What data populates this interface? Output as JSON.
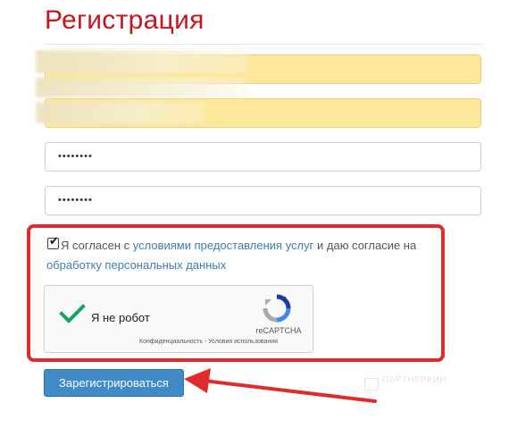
{
  "page": {
    "title": "Регистрация"
  },
  "fields": {
    "password": "••••••••",
    "password_confirm": "••••••••"
  },
  "consent": {
    "prefix": "Я согласен с ",
    "terms_link": "условиями предоставления услуг",
    "middle": " и даю согласие на ",
    "privacy_link": "обработку персональных данных",
    "checked": true
  },
  "captcha": {
    "label": "Я не робот",
    "brand": "reCAPTCHA",
    "privacy": "Конфиденциальность",
    "separator": " - ",
    "terms": "Условия использования"
  },
  "submit": {
    "label": "Зарегистрироваться"
  },
  "watermark": {
    "text": "ПАРТНЕРКИН"
  },
  "colors": {
    "title": "#c4161c",
    "highlight": "#e02b2b",
    "button": "#3f8ac7",
    "link": "#3e7db6",
    "autofill": "#fde89c",
    "check_green": "#1aa260"
  }
}
